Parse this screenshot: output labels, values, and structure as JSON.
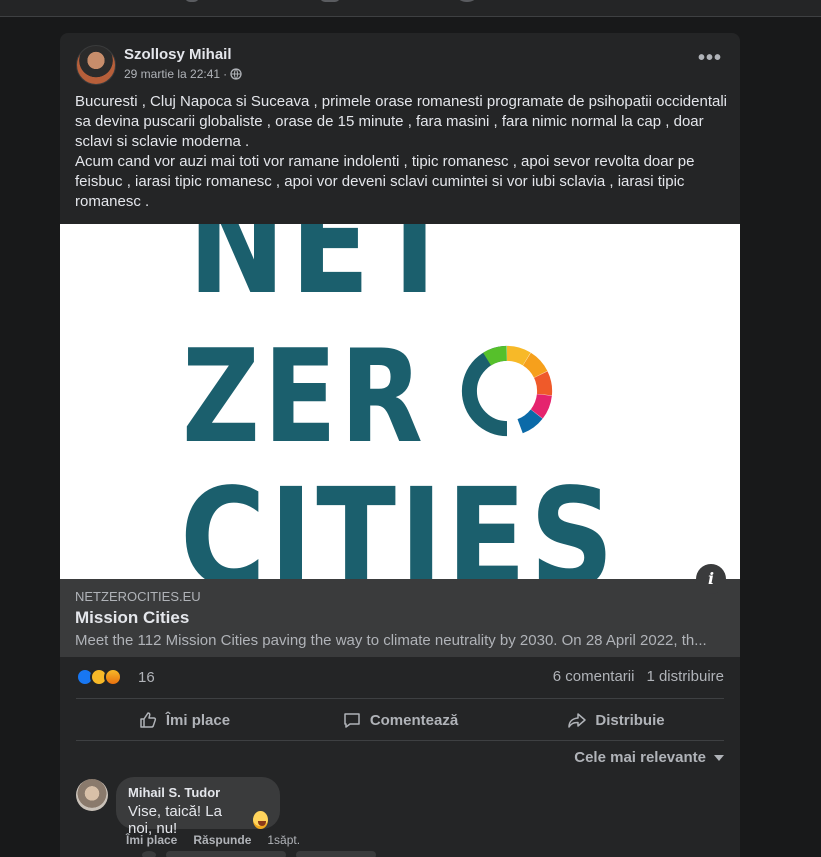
{
  "post": {
    "author": "Szollosy Mihail",
    "timestamp": "29 martie la 22:41",
    "separator": "·",
    "privacy_icon": "globe-icon",
    "more_label": "•••",
    "text_p1": "Bucuresti , Cluj Napoca si Suceava , primele orase romanesti programate de psihopatii occidentali sa devina puscarii globaliste , orase de 15 minute , fara masini , fara nimic normal la cap , doar sclavi si sclavie moderna .",
    "text_p2": "Acum cand vor auzi mai toti vor ramane indolenti , tipic romanesc , apoi sevor revolta doar pe feisbuc , iarasi tipic romanesc , apoi vor deveni sclavi cumintei si vor iubi sclavia , iarasi tipic romanesc ."
  },
  "link_preview": {
    "image_line1": "NET",
    "image_line2": "ZER",
    "image_line3": "CITIES",
    "info_label": "i",
    "domain": "NETZEROCITIES.EU",
    "title": "Mission Cities",
    "description": "Meet the 112 Mission Cities paving the way to climate neutrality by 2030. On 28 April 2022, th..."
  },
  "reactions": {
    "icons": [
      "like",
      "haha",
      "angry"
    ],
    "count": "16",
    "comments": "6 comentarii",
    "shares": "1 distribuire"
  },
  "actions": {
    "like": "Îmi place",
    "comment": "Comentează",
    "share": "Distribuie"
  },
  "sort": {
    "label": "Cele mai relevante"
  },
  "comment": {
    "author": "Mihail S. Tudor",
    "text": "Vise, taică! La noi, nu!",
    "like": "Îmi place",
    "reply": "Răspunde",
    "time": "1săpt."
  },
  "colors": {
    "background": "#18191a",
    "card": "#242526",
    "accent_teal": "#1b5f6d",
    "like_blue": "#1877f2"
  }
}
